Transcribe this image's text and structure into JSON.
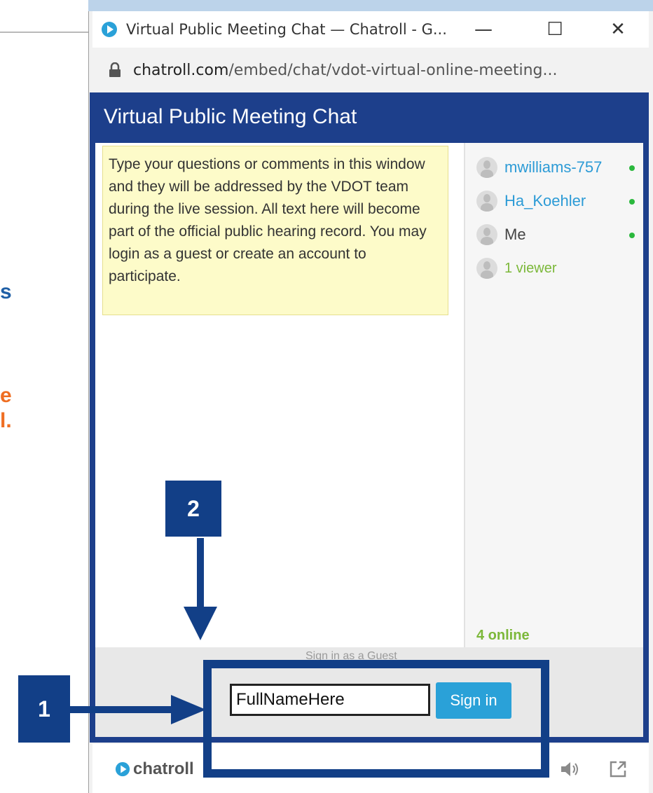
{
  "slide": {
    "frag_blue": "s",
    "frag_orange_1": "e",
    "frag_orange_2": "l."
  },
  "window": {
    "title": "Virtual Public Meeting Chat — Chatroll - G...",
    "minimize": "—",
    "maximize": "☐",
    "close": "✕",
    "url_host": "chatroll.com",
    "url_path": "/embed/chat/vdot-virtual-online-meeting..."
  },
  "chat": {
    "title": "Virtual Public Meeting Chat",
    "notice": "Type your questions or comments in this window and they will be addressed by the VDOT team during the live session. All text here will become part of the official public hearing record. You may login as a guest or create an account to participate.",
    "users": [
      {
        "name": "mwilliams-757",
        "online": true
      },
      {
        "name": "Ha_Koehler",
        "online": true
      },
      {
        "name": "Me",
        "online": true
      }
    ],
    "viewers": "1 viewer",
    "online_count": "4 online",
    "signin_label": "Sign in as a Guest",
    "name_value": "FullNameHere",
    "signin_button": "Sign in"
  },
  "footer": {
    "brand": "chatroll"
  },
  "annotations": {
    "callout_1": "1",
    "callout_2": "2"
  },
  "colors": {
    "chat_header": "#1d3f8b",
    "annotation": "#123f87",
    "signin_button": "#2aa1d8",
    "online_green": "#2bb83d",
    "viewer_green": "#7cb83a"
  }
}
